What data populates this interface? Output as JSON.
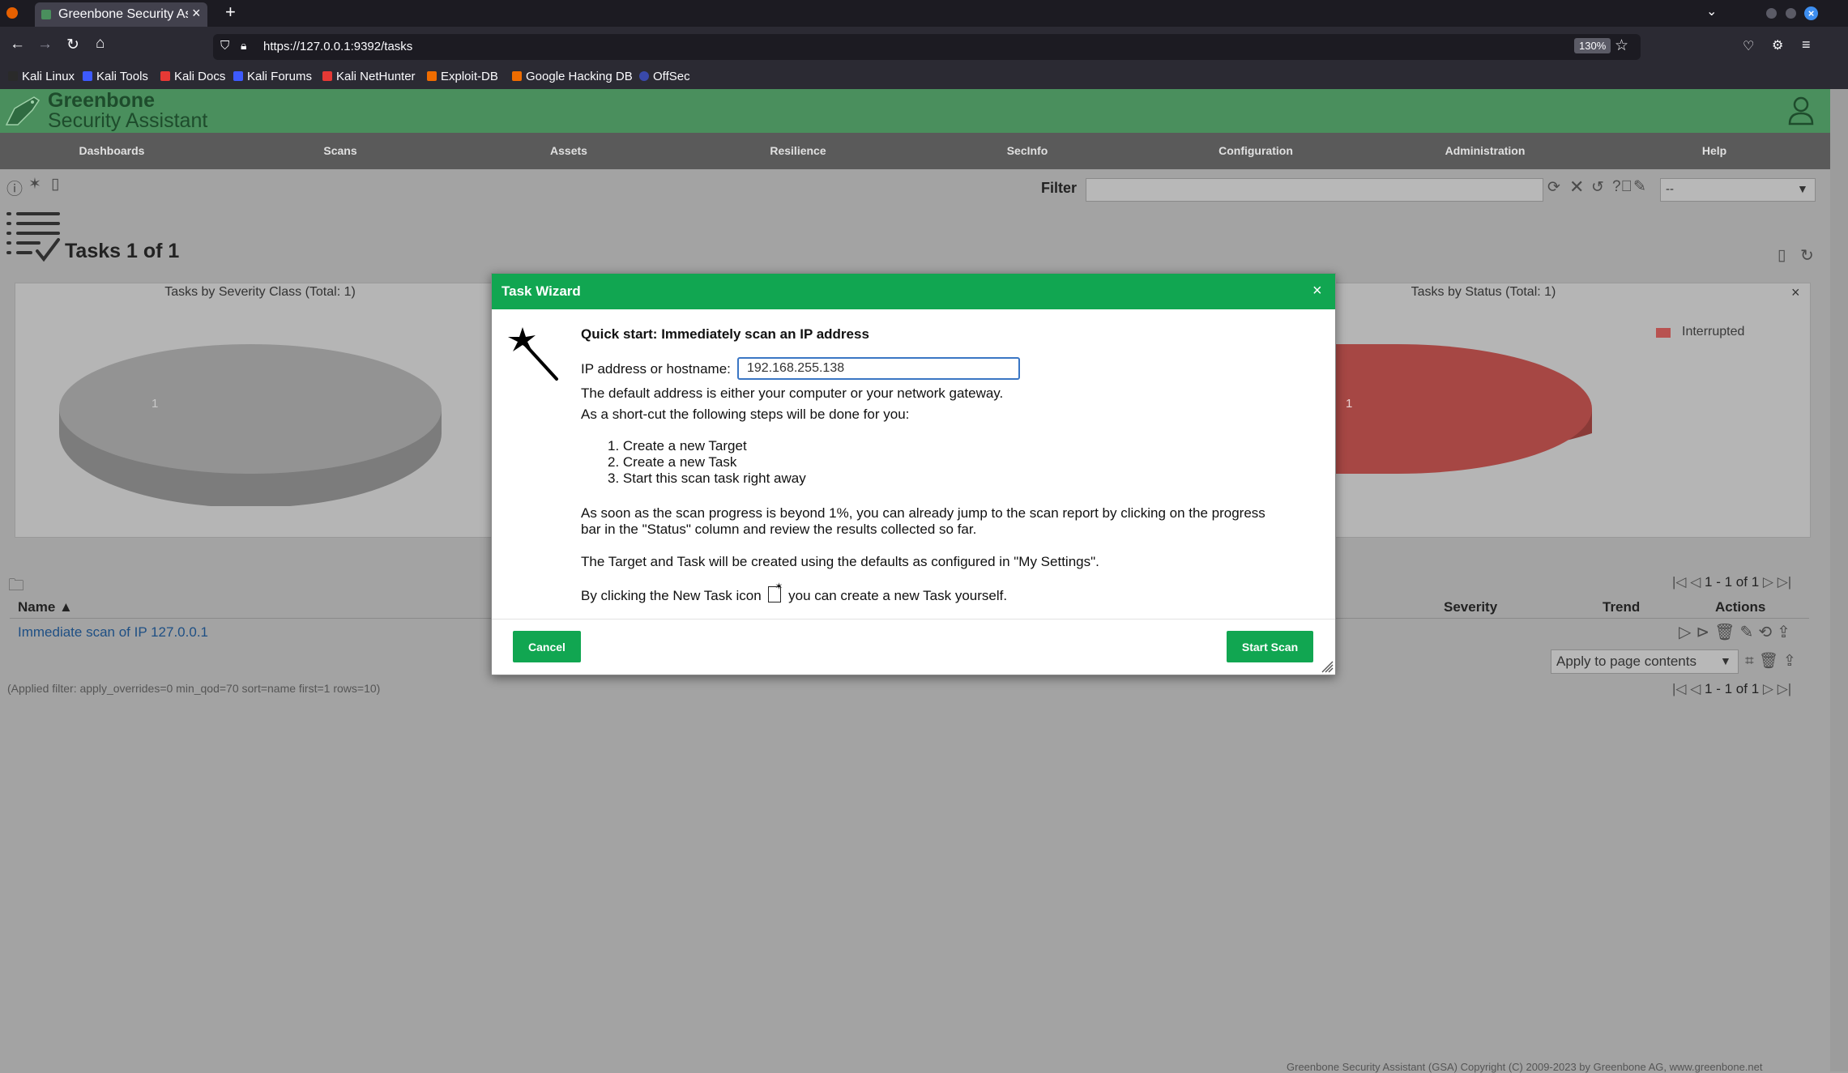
{
  "browser": {
    "tab_title": "Greenbone Security Assis",
    "url": "https://127.0.0.1:9392/tasks",
    "zoom": "130%",
    "bookmarks": [
      {
        "label": "Kali Linux",
        "color": "#2a2a2a"
      },
      {
        "label": "Kali Tools",
        "color": "#3d5afe"
      },
      {
        "label": "Kali Docs",
        "color": "#e53935"
      },
      {
        "label": "Kali Forums",
        "color": "#3d5afe"
      },
      {
        "label": "Kali NetHunter",
        "color": "#e53935"
      },
      {
        "label": "Exploit-DB",
        "color": "#ef6c00"
      },
      {
        "label": "Google Hacking DB",
        "color": "#ef6c00"
      },
      {
        "label": "OffSec",
        "color": "#3949ab"
      }
    ]
  },
  "app": {
    "logo_line1": "Greenbone",
    "logo_line2": "Security Assistant",
    "nav": [
      "Dashboards",
      "Scans",
      "Assets",
      "Resilience",
      "SecInfo",
      "Configuration",
      "Administration",
      "Help"
    ],
    "filter_label": "Filter",
    "filter_value": "",
    "filter_select": "--",
    "page_title": "Tasks 1 of 1",
    "chart_left_title": "Tasks by Severity Class (Total: 1)",
    "chart_left_label": "1",
    "chart_right_title": "Tasks by Status (Total: 1)",
    "chart_right_label": "1",
    "chart_right_legend": "Interrupted",
    "pager_top": "1 - 1 of 1",
    "pager_bottom": "1 - 1 of 1",
    "table": {
      "col_name": "Name ▲",
      "col_severity": "Severity",
      "col_trend": "Trend",
      "col_actions": "Actions",
      "row_name": "Immediate scan of IP 127.0.0.1"
    },
    "bulk_select": "Apply to page contents",
    "applied_filter": "(Applied filter: apply_overrides=0 min_qod=70 sort=name first=1 rows=10)",
    "footer": "Greenbone Security Assistant (GSA) Copyright (C) 2009-2023 by Greenbone AG, www.greenbone.net"
  },
  "wizard": {
    "title": "Task Wizard",
    "heading": "Quick start: Immediately scan an IP address",
    "ip_label": "IP address or hostname:",
    "ip_value": "192.168.255.138",
    "line1": "The default address is either your computer or your network gateway.",
    "line2": "As a short-cut the following steps will be done for you:",
    "steps": [
      "1. Create a new Target",
      "2. Create a new Task",
      "3. Start this scan task right away"
    ],
    "para1": "As soon as the scan progress is beyond 1%, you can already jump to the scan report by clicking on the progress bar in the \"Status\" column and review the results collected so far.",
    "para2": "The Target and Task will be created using the defaults as configured in \"My Settings\".",
    "para3_a": "By clicking the New Task icon",
    "para3_b": "you can create a new Task yourself.",
    "cancel": "Cancel",
    "start": "Start Scan"
  },
  "colors": {
    "green": "#11a651",
    "header_green": "#4a8f5d",
    "interrupted": "#c0504d"
  }
}
